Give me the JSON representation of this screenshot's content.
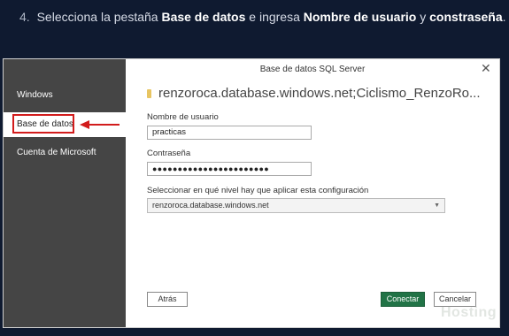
{
  "instruction": {
    "number": "4.",
    "text_before": "Selecciona la pestaña ",
    "bold1": "Base de datos",
    "text_middle": " e ingresa ",
    "bold2": "Nombre de usuario",
    "text_and": " y ",
    "bold3": "constraseña",
    "text_end": "."
  },
  "dialog": {
    "title": "Base de datos SQL Server",
    "close_icon": "close-icon",
    "server": "renzoroca.database.windows.net;Ciclismo_RenzoRo...",
    "sidebar": {
      "items": [
        {
          "label": "Windows"
        },
        {
          "label": "Base de datos",
          "selected": true
        },
        {
          "label": "Cuenta de Microsoft"
        }
      ]
    },
    "username": {
      "label": "Nombre de usuario",
      "value": "practicas"
    },
    "password": {
      "label": "Contraseña",
      "value": "●●●●●●●●●●●●●●●●●●●●●●●"
    },
    "level": {
      "label": "Seleccionar en qué nivel hay que aplicar esta configuración",
      "selected": "renzoroca.database.windows.net"
    },
    "buttons": {
      "back": "Atrás",
      "connect": "Conectar",
      "cancel": "Cancelar"
    },
    "accent_color": "#217346",
    "highlight_color": "#d21c1c"
  },
  "watermark": "Hosting"
}
